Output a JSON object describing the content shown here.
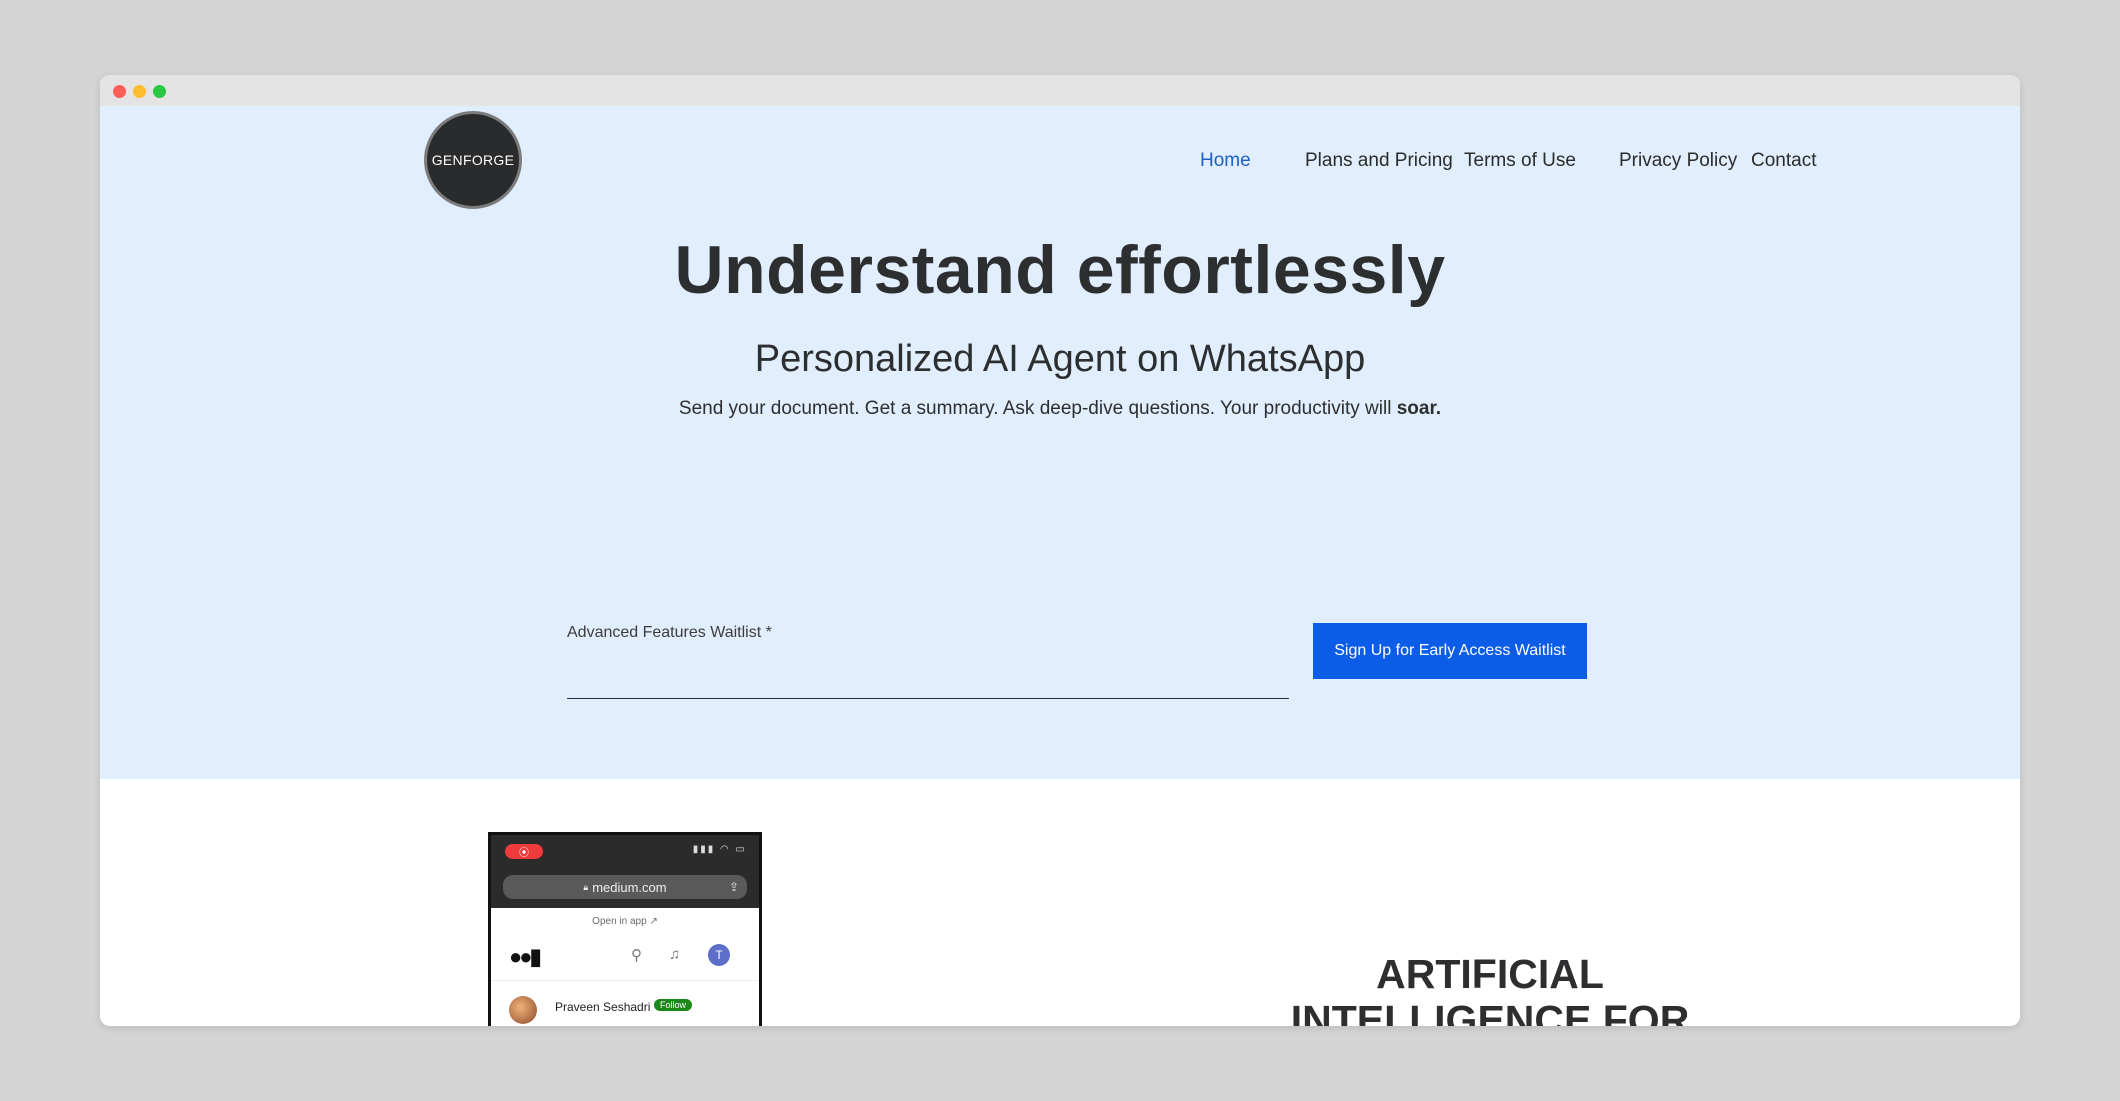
{
  "brand": {
    "logo_text": "GENFORGE"
  },
  "nav": {
    "items": [
      {
        "label": "Home",
        "active": true
      },
      {
        "label": "Plans and Pricing"
      },
      {
        "label": "Terms of Use"
      },
      {
        "label": "Privacy Policy"
      },
      {
        "label": "Contact"
      }
    ]
  },
  "hero": {
    "headline": "Understand effortlessly",
    "subheadline": "Personalized AI Agent on WhatsApp",
    "tagline_prefix": "Send your document. Get a summary. Ask deep-dive questions. Your productivity will ",
    "tagline_emphasis": "soar."
  },
  "waitlist": {
    "label": "Advanced Features Waitlist *",
    "value": "",
    "button_label": "Sign Up for Early Access Waitlist"
  },
  "phone_preview": {
    "url": "medium.com",
    "open_in_app": "Open in app ↗",
    "avatar_letter": "T",
    "author": "Praveen Seshadri",
    "follow_label": "Follow"
  },
  "section2": {
    "heading_line1": "ARTIFICIAL",
    "heading_line2": "INTELLIGENCE FOR"
  },
  "colors": {
    "hero_bg": "#e1eefd",
    "accent": "#0b5ce6",
    "nav_active": "#1c5fc9",
    "text": "#2d2e30"
  }
}
